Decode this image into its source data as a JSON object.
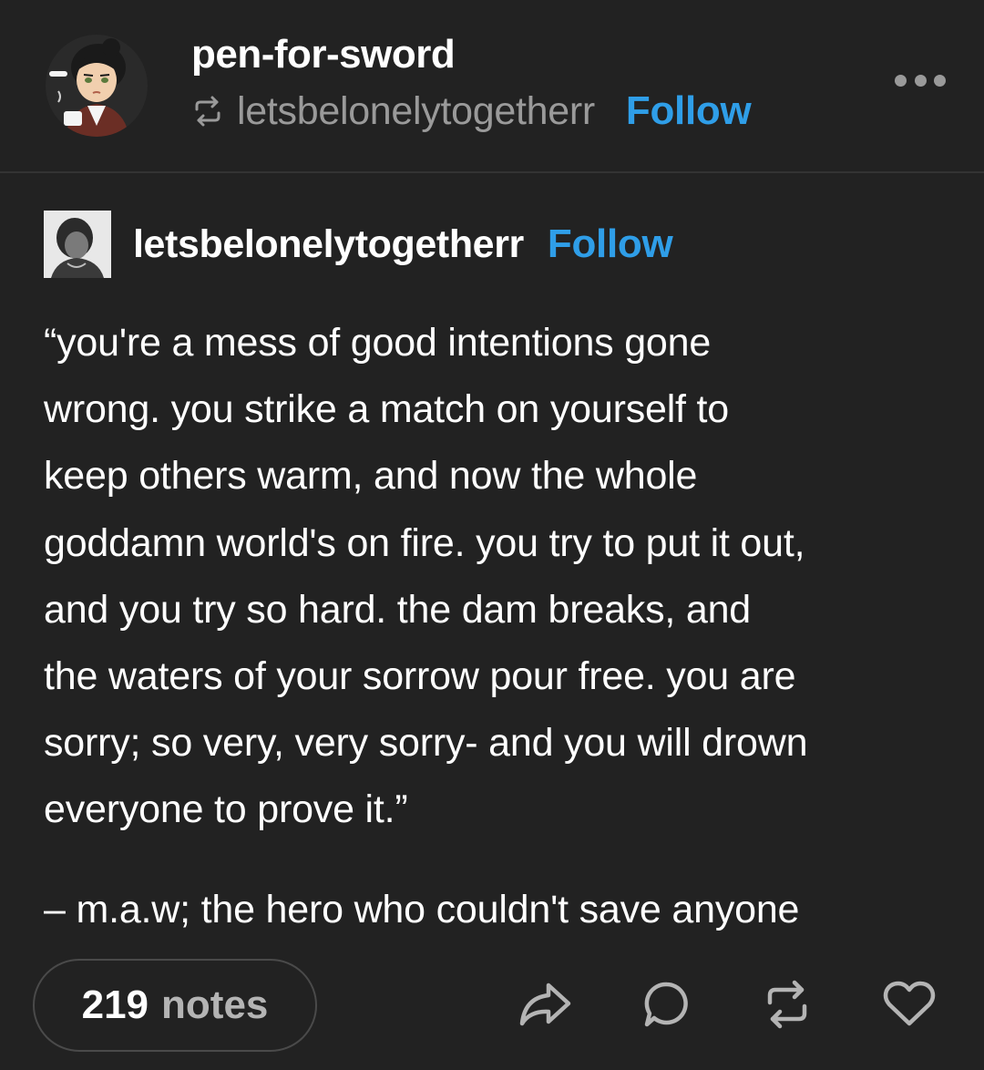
{
  "header": {
    "username": "pen-for-sword",
    "reblogged_from": "letsbelonelytogetherr",
    "follow_label": "Follow",
    "avatar_icon": "cartoon-avatar-icon",
    "more_icon": "ellipsis-icon",
    "reblog_icon": "reblog-icon"
  },
  "post": {
    "source_blog": "letsbelonelytogetherr",
    "follow_label": "Follow",
    "avatar_icon": "photo-avatar-icon",
    "quote_lines": [
      "“you're a mess of good intentions gone",
      "wrong. you strike a match on yourself to",
      "keep others warm, and now the whole",
      "goddamn world's on fire. you try to put it out,",
      "and you try so hard. the dam breaks, and",
      "the waters of your sorrow pour free. you are",
      "sorry; so very, very sorry- and you will drown",
      "everyone to prove it.”"
    ],
    "attribution": "– m.a.w; the hero who couldn't save anyone"
  },
  "footer": {
    "notes_count": "219",
    "notes_label": "notes",
    "actions": [
      "share-icon",
      "reply-icon",
      "reblog-icon",
      "like-heart-icon"
    ]
  },
  "colors": {
    "background": "#222222",
    "accent_blue": "#2f9ee8",
    "muted_text": "#9a9a9a"
  }
}
